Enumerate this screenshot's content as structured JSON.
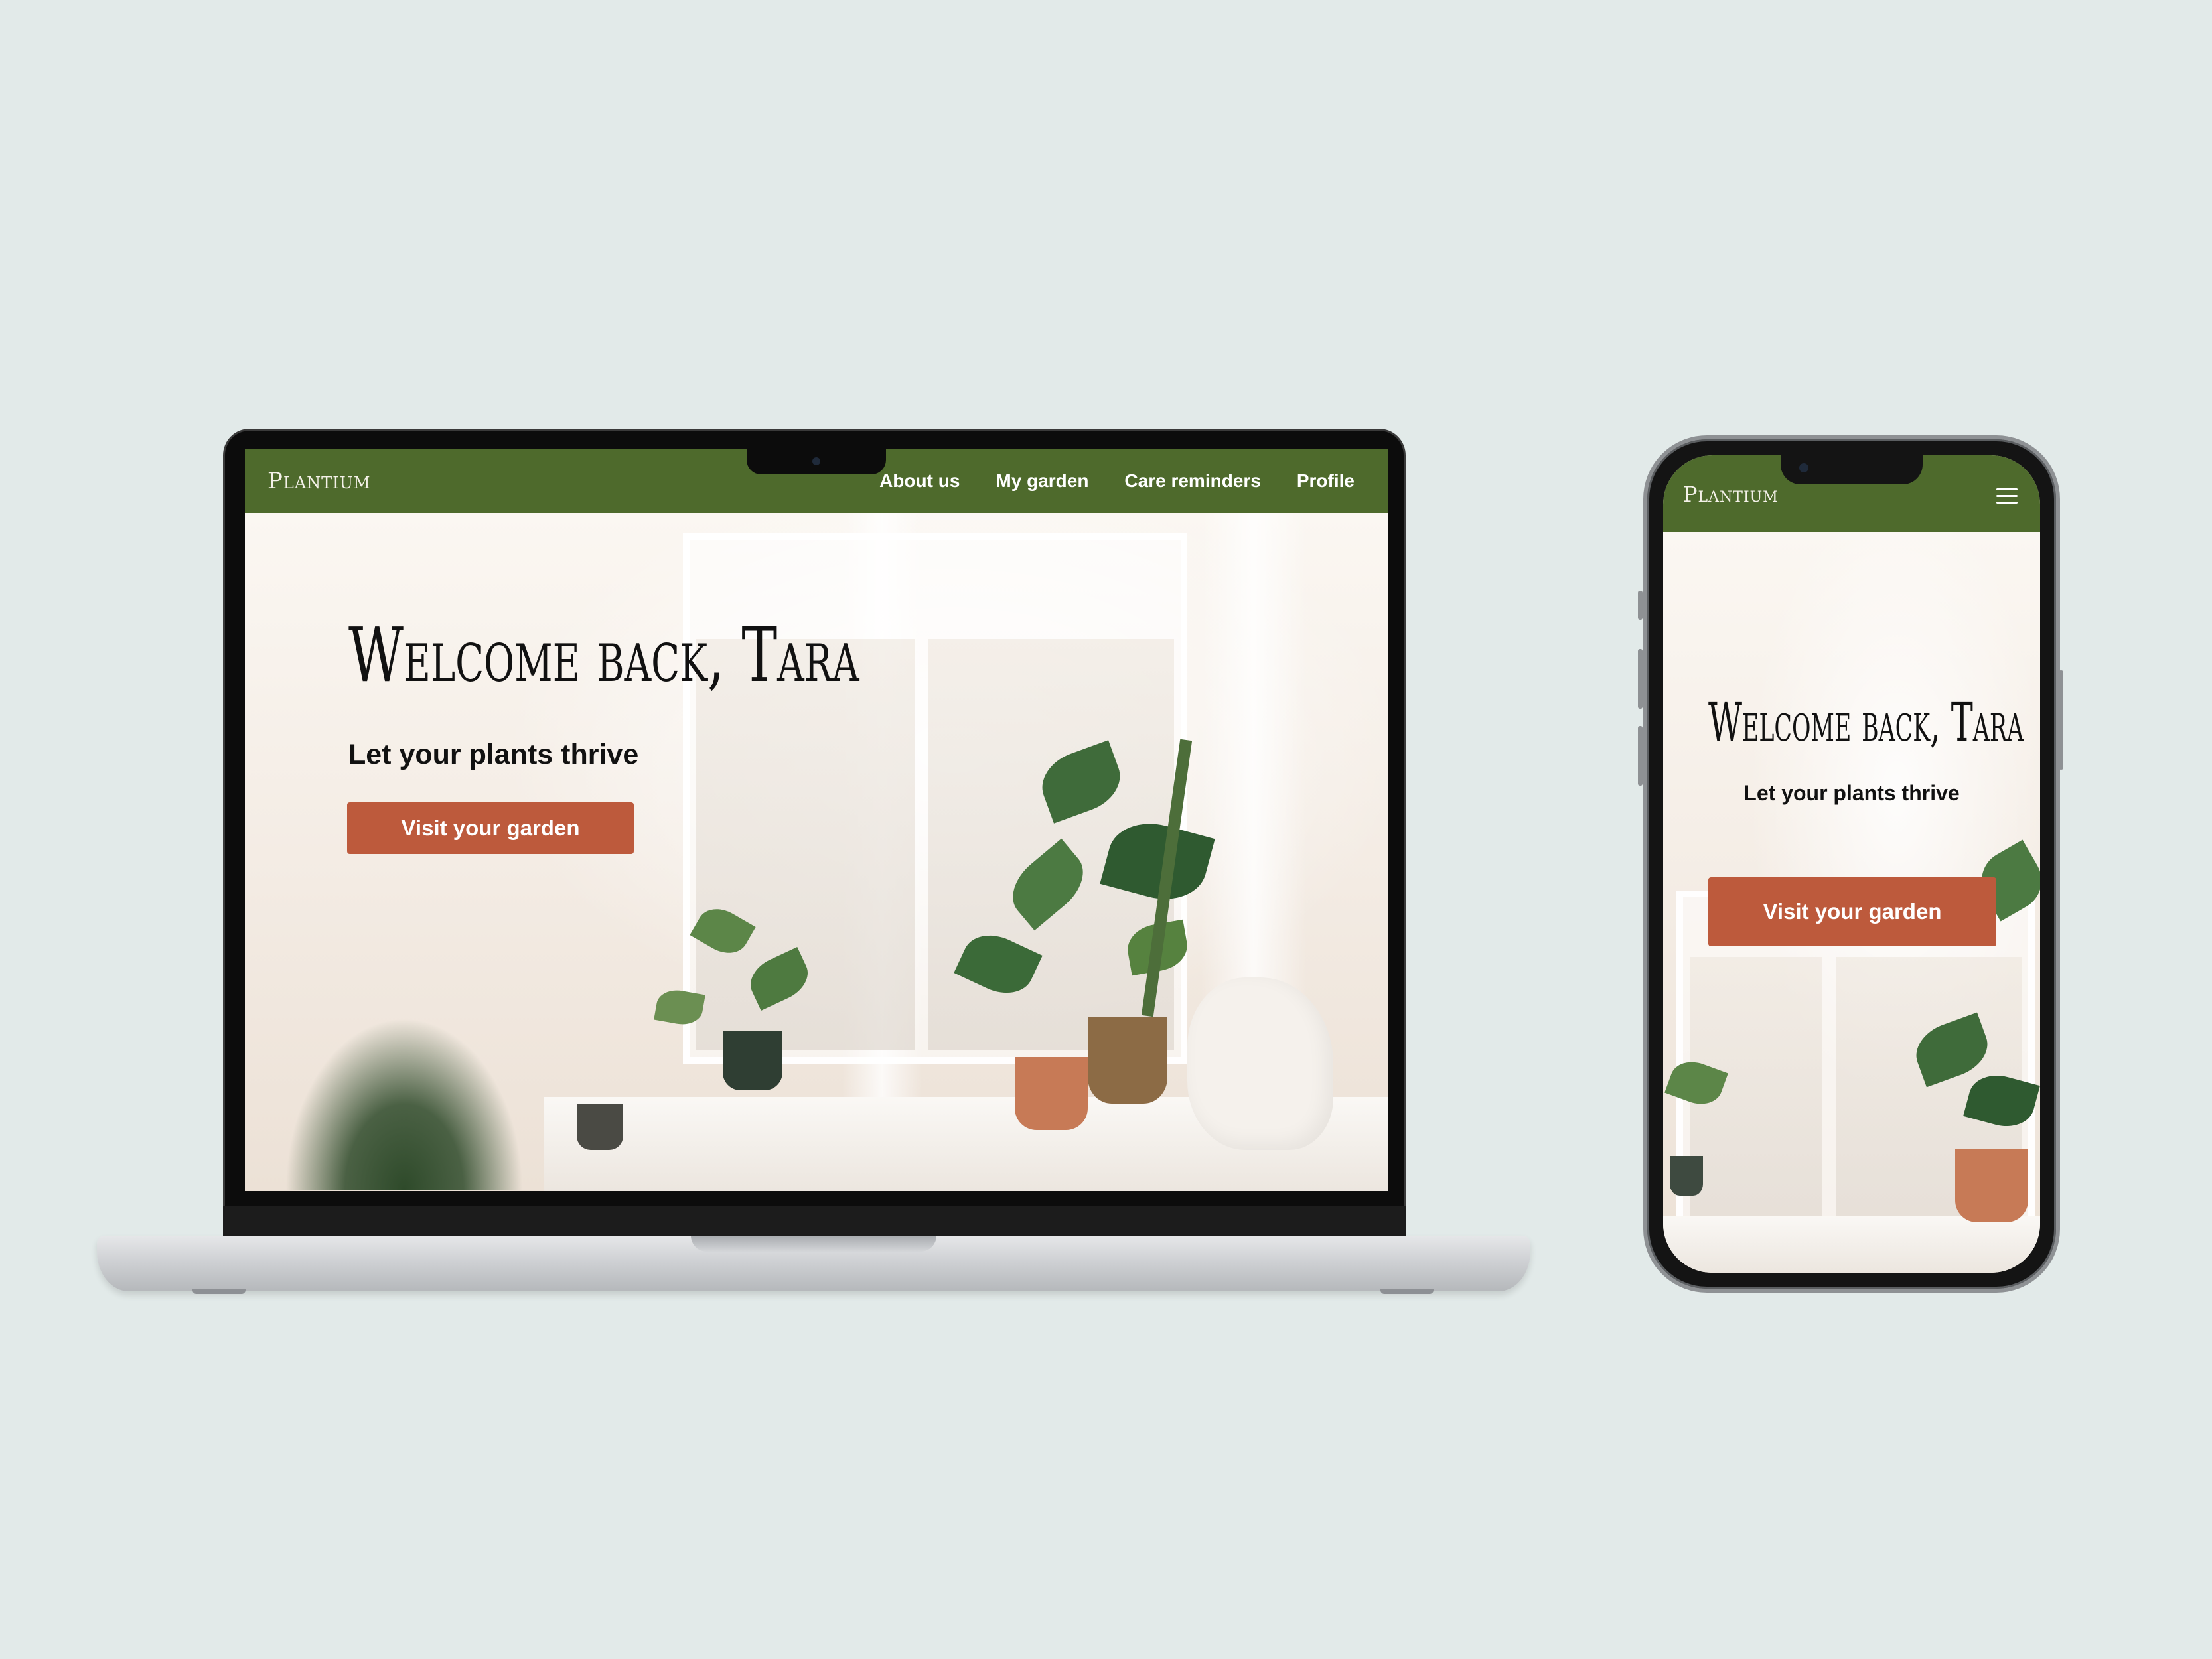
{
  "brand": {
    "name": "Plantium"
  },
  "desktop": {
    "nav": {
      "links": [
        "About us",
        "My garden",
        "Care reminders",
        "Profile"
      ]
    },
    "hero": {
      "greeting": "Welcome back, Tara",
      "tagline": "Let your plants thrive",
      "cta_label": "Visit your garden"
    }
  },
  "mobile": {
    "nav": {
      "menu_icon": "hamburger-menu-icon"
    },
    "hero": {
      "greeting": "Welcome back, Tara",
      "tagline": "Let your plants thrive",
      "cta_label": "Visit your garden"
    }
  },
  "colors": {
    "nav_green": "#4e6a2c",
    "cta_terracotta": "#bd5a3c",
    "backdrop": "#e2eae9"
  }
}
